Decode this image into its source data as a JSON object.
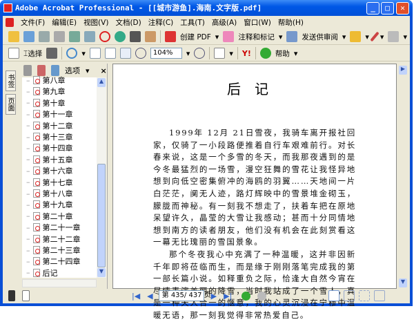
{
  "window": {
    "title": "Adobe Acrobat Professional - [[城市游鱼].海南.文字版.pdf]"
  },
  "menu": [
    "文件(F)",
    "编辑(E)",
    "视图(V)",
    "文档(D)",
    "注释(C)",
    "工具(T)",
    "高级(A)",
    "窗口(W)",
    "帮助(H)"
  ],
  "toolbar1": {
    "create_pdf": "创建 PDF",
    "comment_markup": "注释和标记",
    "send_review": "发送供审阅"
  },
  "toolbar2": {
    "select": "选择",
    "zoom": "104%",
    "help": "帮助"
  },
  "nav_tabs": [
    "书签",
    "页面"
  ],
  "panel": {
    "options": "选项",
    "close": "×",
    "items": [
      "第八章",
      "第九章",
      "第十章",
      "第十一章",
      "第十二章",
      "第十三章",
      "第十四章",
      "第十五章",
      "第十六章",
      "第十七章",
      "第十八章",
      "第十九章",
      "第二十章",
      "第二十一章",
      "第二十二章",
      "第二十三章",
      "第二十四章",
      "后记"
    ]
  },
  "document": {
    "title": "后记",
    "paragraphs": [
      "1999年 12月 21日雪夜，我骑车离开报社回家，仅骑了一小段路便推着自行车艰难前行。对长春来说，这是一个多雪的冬天，而我那夜遇到的是今冬最猛烈的一场雪，漫空狂舞的雪花让我怪异地想到向低空密集俯冲的海鸥的羽翼……天地间一片白茫茫，阒无人迹，路灯辉映中的雪景堆金砌玉，朦胧而神秘。有一刻我不想走了，扶着车把在原地呆望许久，晶莹的大雪让我感动；甚而十分同情地想到南方的读者朋友，他们没有机会在此刻赏看这一幕无比瑰丽的雪国景象。",
      "那个冬夜我心中充满了一种温暖，这并非因新千年即将莅临而生，而是缘于刚刚落笔完成我的第一部长篇小说。如释重负之际，恰逢大自然今宵在尽情表演美丽的降雪，当时我站成了一个雪人，真是一种天人合一的惬意，我的心灵沉浸在宁穆中温暖无语，那一刻我觉得非常热爱自己。"
    ]
  },
  "status": {
    "page": "第 435/ 437 页"
  }
}
